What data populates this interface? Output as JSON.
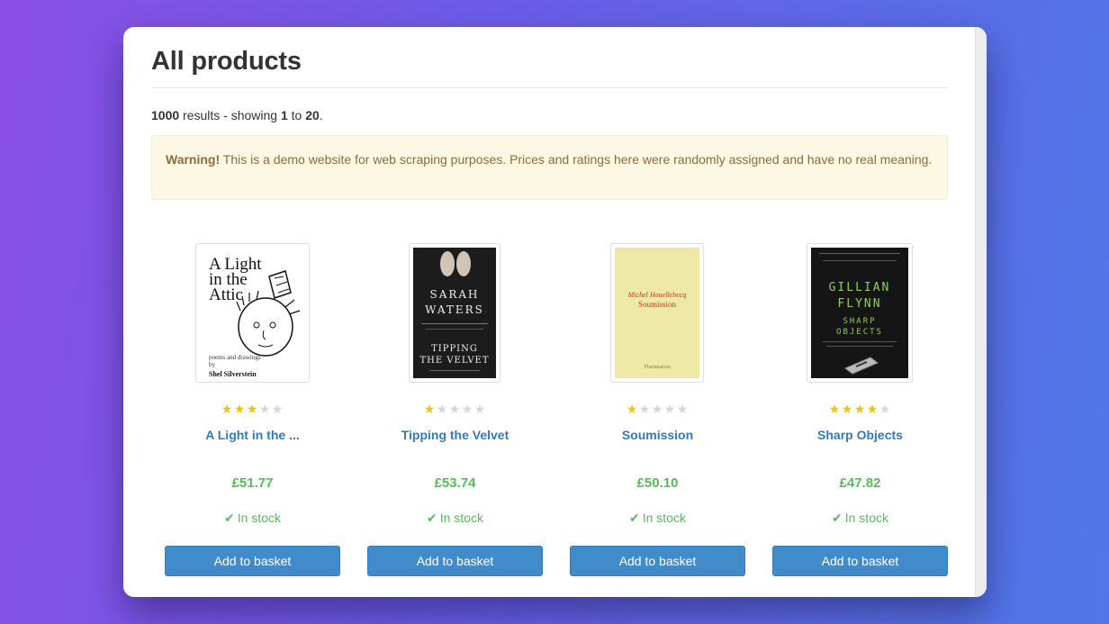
{
  "page": {
    "title": "All products",
    "results": {
      "total": "1000",
      "text_mid": " results - showing ",
      "from": "1",
      "to_word": " to ",
      "to": "20",
      "end": "."
    },
    "alert": {
      "label": "Warning!",
      "text": " This is a demo website for web scraping purposes. Prices and ratings here were randomly assigned and have no real meaning."
    }
  },
  "colors": {
    "accent": "#428bca",
    "price": "#5cb85c",
    "link": "#337ab7",
    "star_on": "#e6c515",
    "star_off": "#d6d6d6"
  },
  "products": [
    {
      "title": "A Light in the ...",
      "rating": 3,
      "price": "£51.77",
      "availability": "In stock",
      "button": "Add to basket",
      "cover": {
        "line1": "A Light",
        "line2": "in the",
        "line3": "Attic",
        "small": "poems and drawings by",
        "author": "Shel Silverstein"
      }
    },
    {
      "title": "Tipping the Velvet",
      "rating": 1,
      "price": "£53.74",
      "availability": "In stock",
      "button": "Add to basket",
      "cover": {
        "author1": "SARAH",
        "author2": "WATERS",
        "title1": "TIPPING",
        "title2": "THE VELVET"
      }
    },
    {
      "title": "Soumission",
      "rating": 1,
      "price": "£50.10",
      "availability": "In stock",
      "button": "Add to basket",
      "cover": {
        "author": "Michel Houellebecq",
        "title": "Soumission",
        "publisher": "Flammarion"
      }
    },
    {
      "title": "Sharp Objects",
      "rating": 4,
      "price": "£47.82",
      "availability": "In stock",
      "button": "Add to basket",
      "cover": {
        "author1": "GILLIAN",
        "author2": "FLYNN",
        "title1": "SHARP",
        "title2": "OBJECTS"
      }
    }
  ],
  "icons": {
    "star": "star-icon",
    "check": "check-icon"
  }
}
